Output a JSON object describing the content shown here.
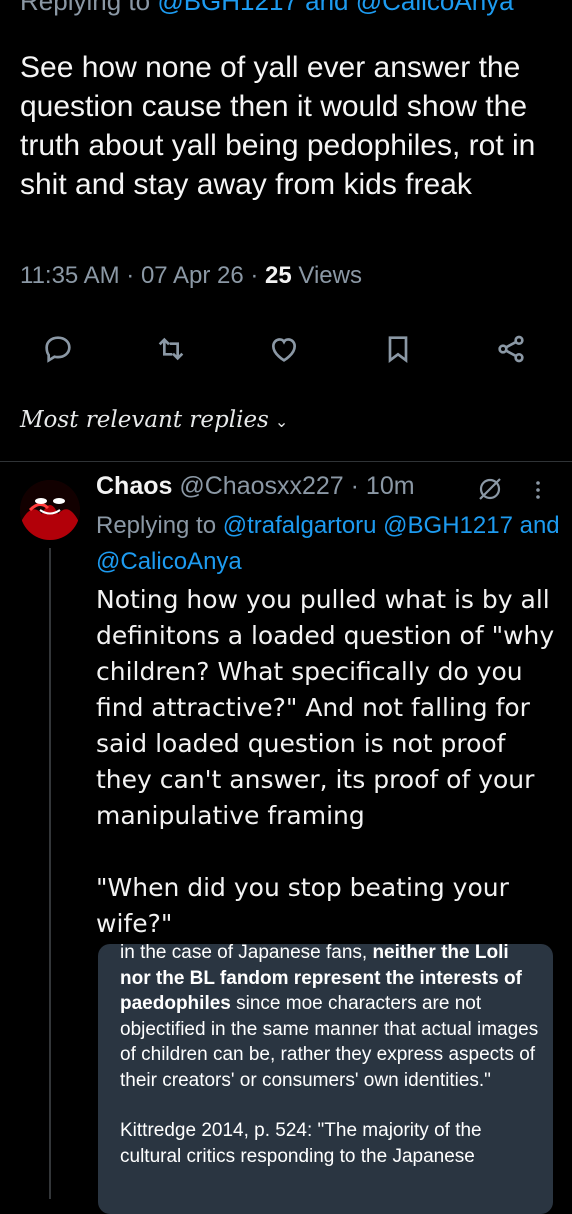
{
  "top_tweet": {
    "replying_prefix": "Replying to ",
    "replying_mentions": "@BGH1217 and @CalicoAnya",
    "text": "See how none of yall ever answer the question cause then it would show the truth about yall being pedophiles, rot in shit and stay away from kids freak",
    "meta_time": "11:35 AM · 07 Apr 26 · ",
    "views_count": "25",
    "views_label": " Views"
  },
  "actions": {
    "icons": [
      "reply-icon",
      "retweet-icon",
      "like-icon",
      "bookmark-icon",
      "share-icon"
    ]
  },
  "sort": {
    "label": "Most relevant replies",
    "chevron": "⌄"
  },
  "reply": {
    "name": "Chaos",
    "handle_time": " @Chaosxx227 · 10m",
    "replying_prefix": "Replying to ",
    "replying_mentions": "@trafalgartoru @BGH1217 and @CalicoAnya",
    "paragraph1": "Noting how you pulled what is by all definitons a loaded question of \"why children? What specifically do you find attractive?\" And not falling for said loaded question is not proof they can't answer, its proof of your manipulative framing",
    "paragraph2": "\"When did you stop beating your wife?\"",
    "more_icon": "⋮"
  },
  "quote_image": {
    "line_intro": "in the case of Japanese fans, ",
    "bold_text": "neither the Loli nor the BL fandom represent the interests of paedophiles",
    "rest_text": " since moe characters are not objectified in the same manner that actual images of children can be, rather they express aspects of their creators' or consumers' own identities.\"",
    "citation": "Kittredge 2014, p. 524: \"The majority of the cultural critics responding to the Japanese"
  },
  "colors": {
    "background": "#000000",
    "text_primary": "#e7e9ea",
    "text_secondary": "#8b98a5",
    "accent": "#1d9bf0",
    "quote_card_bg": "#2a3541"
  }
}
